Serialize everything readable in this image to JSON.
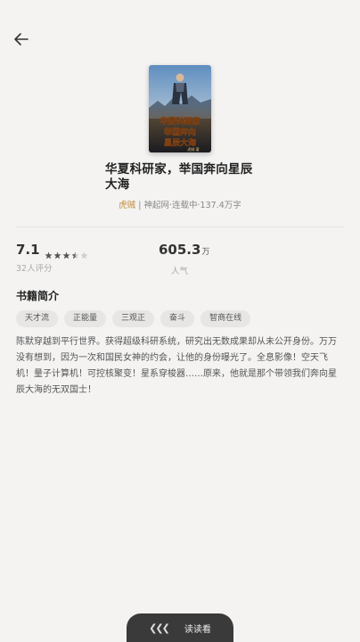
{
  "header": {
    "back_icon": "arrow-left-icon"
  },
  "book": {
    "cover_title": "华夏科研家 举国奔向 星辰大海",
    "cover_author": "虎贼",
    "title": "华夏科研家，举国奔向星辰大海",
    "author": "虎贼",
    "meta_rest": " | 神起网·连载中·137.4万字"
  },
  "stats": {
    "rating": "7.1",
    "stars_value": 3.5,
    "stars_total": 5,
    "rating_count": "32人评分",
    "popularity": "605.3",
    "popularity_unit": "万",
    "popularity_label": "人气"
  },
  "intro": {
    "section_title": "书籍简介",
    "tags": [
      "天才流",
      "正能量",
      "三观正",
      "奋斗",
      "智商在线"
    ],
    "description": "陈默穿越到平行世界。获得超级科研系统，研究出无数成果却从未公开身份。万万没有想到，因为一次和国民女神的约会，让他的身份曝光了。全息影像！空天飞机！量子计算机！可控核聚变！星系穿梭器……原来，他就是那个带领我们奔向星辰大海的无双国士！"
  },
  "footer": {
    "read_label": "读读看",
    "chevron_icon": "double-chevron-left-icon"
  },
  "colors": {
    "background": "#f4f3f2",
    "author": "#c38a3a",
    "button": "#3a3a3a"
  }
}
